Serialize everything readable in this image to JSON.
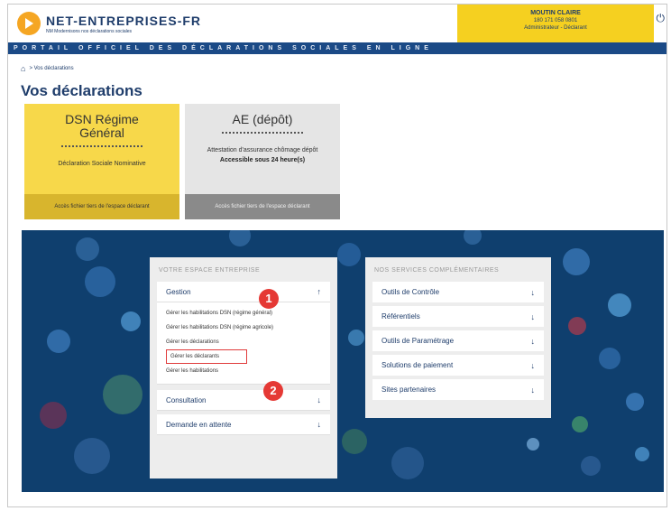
{
  "header": {
    "logo_title": "NET-ENTREPRISES-FR",
    "logo_subtitle": "NM Modernisons nos déclarations sociales",
    "user_name": "MOUTIN CLAIRE",
    "user_id": "180 171 058 0801",
    "user_role": "Administrateur - Déclarant",
    "icon": "power-icon",
    "portal_band": "PORTAIL OFFICIEL DES DÉCLARATIONS SOCIALES EN LIGNE"
  },
  "breadcrumb": {
    "home_icon": "home-icon",
    "current": "> Vos déclarations"
  },
  "page_title": "Vos déclarations",
  "cards": [
    {
      "title": "DSN Régime Général",
      "desc": "Déclaration Sociale Nominative",
      "footer": "Accès fichier tiers de l'espace déclarant"
    },
    {
      "title": "AE (dépôt)",
      "desc": "Attestation d'assurance chômage dépôt",
      "sub": "Accessible sous 24 heure(s)",
      "footer": "Accès fichier tiers de l'espace déclarant"
    }
  ],
  "left_panel": {
    "heading": "VOTRE ESPACE ENTREPRISE",
    "gestion_label": "Gestion",
    "gestion_arrow": "↑",
    "sub_links": [
      "Gérer les habilitations DSN (régime général)",
      "Gérer les habilitations DSN (régime agricole)",
      "Gérer les déclarations",
      "Gérer les déclarants",
      "Gérer les habilitations"
    ],
    "consultation_label": "Consultation",
    "demande_label": "Demande en attente",
    "arrow_down": "↓"
  },
  "right_panel": {
    "heading": "NOS SERVICES COMPLÉMENTAIRES",
    "items": [
      "Outils de Contrôle",
      "Référentiels",
      "Outils de Paramétrage",
      "Solutions de paiement",
      "Sites partenaires"
    ],
    "arrow_down": "↓"
  },
  "badges": [
    "1",
    "2"
  ],
  "colors": {
    "brand_blue": "#1f3d6b",
    "band_blue": "#1b4a86",
    "yellow": "#f5d020",
    "badge_red": "#e53935"
  }
}
